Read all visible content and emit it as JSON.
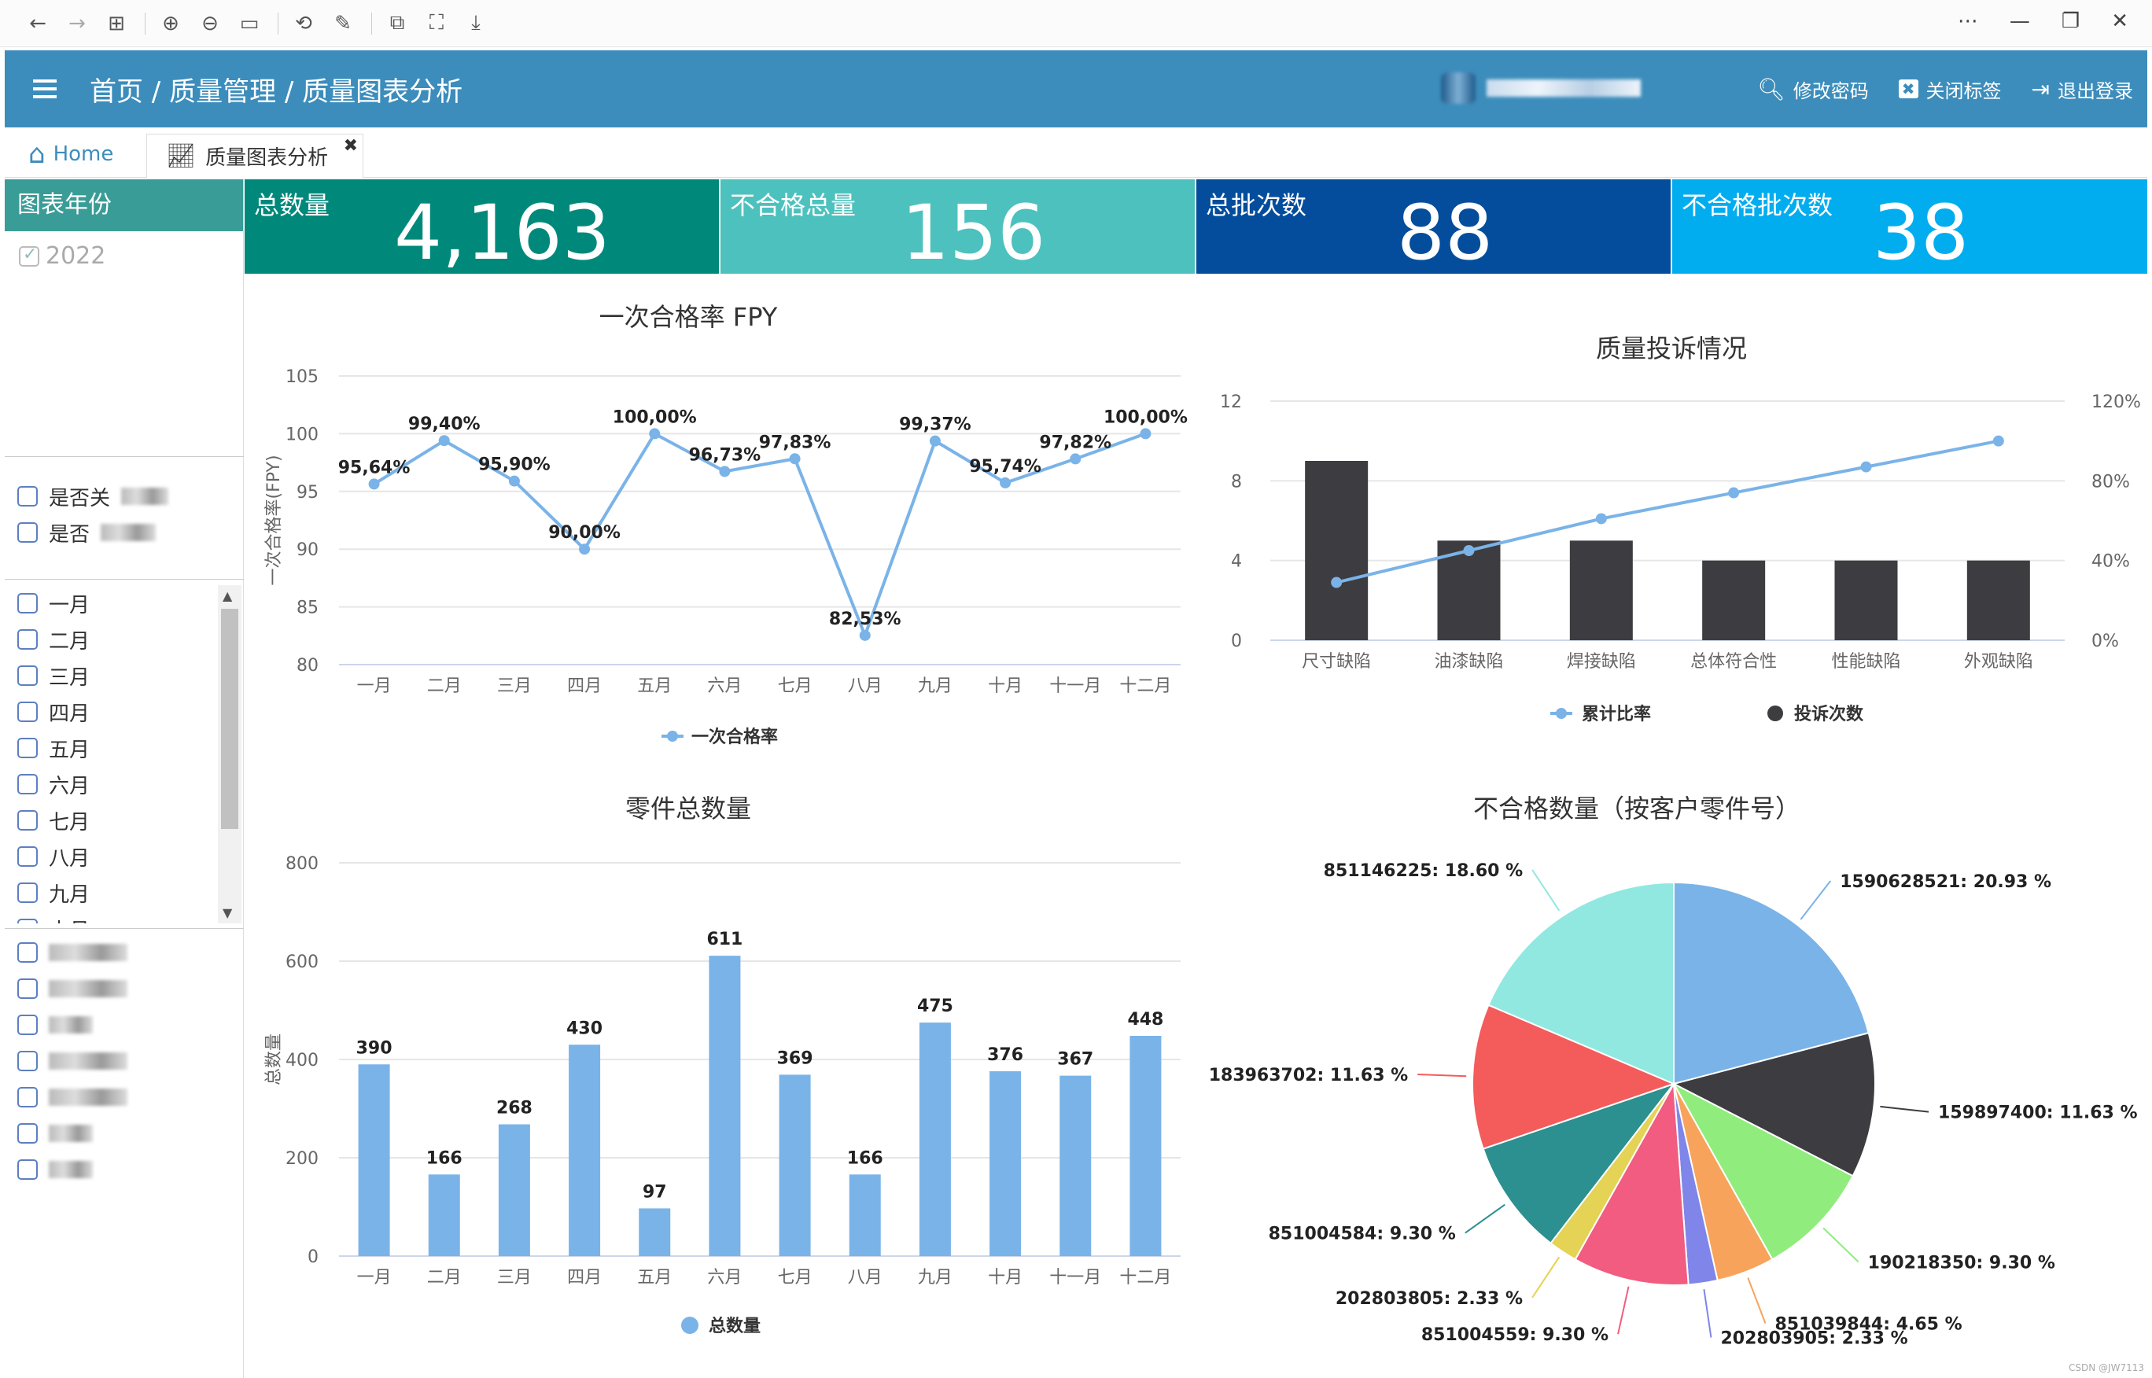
{
  "header": {
    "breadcrumb": "首页 / 质量管理 / 质量图表分析",
    "actions": [
      "修改密码",
      "关闭标签",
      "退出登录"
    ],
    "color": "#3c8dbc"
  },
  "tabs": {
    "home": "Home",
    "active": "质量图表分析"
  },
  "sidebar": {
    "title": "图表年份",
    "year": "2022",
    "group1": [
      "是否关",
      "是否"
    ],
    "months": [
      "一月",
      "二月",
      "三月",
      "四月",
      "五月",
      "六月",
      "七月",
      "八月",
      "九月",
      "十月"
    ]
  },
  "kpis": [
    {
      "label": "总数量",
      "value": "4,163",
      "color": "#00897b"
    },
    {
      "label": "不合格总量",
      "value": "156",
      "color": "#4dc1bd"
    },
    {
      "label": "总批次数",
      "value": "88",
      "color": "#034d9c"
    },
    {
      "label": "不合格批次数",
      "value": "38",
      "color": "#02adef"
    }
  ],
  "footer_credit": "CSDN @JW7113",
  "chart_data": [
    {
      "type": "line",
      "title": "一次合格率 FPY",
      "ylabel": "一次合格率(FPY)",
      "categories": [
        "一月",
        "二月",
        "三月",
        "四月",
        "五月",
        "六月",
        "七月",
        "八月",
        "九月",
        "十月",
        "十一月",
        "十二月"
      ],
      "series": [
        {
          "name": "一次合格率",
          "values": [
            95.64,
            99.4,
            95.9,
            90.0,
            100.0,
            96.73,
            97.83,
            82.53,
            99.37,
            95.74,
            97.82,
            100.0
          ],
          "labels": [
            "95,64%",
            "99,40%",
            "95,90%",
            "90,00%",
            "100,00%",
            "96,73%",
            "97,83%",
            "82,53%",
            "99,37%",
            "95,74%",
            "97,82%",
            "100,00%"
          ]
        }
      ],
      "ylim": [
        80,
        105
      ],
      "yticks": [
        "80",
        "85",
        "90",
        "95",
        "100",
        "105"
      ],
      "color": "#7ab3e8"
    },
    {
      "type": "bar",
      "title": "质量投诉情况",
      "categories": [
        "尺寸缺陷",
        "油漆缺陷",
        "焊接缺陷",
        "总体符合性",
        "性能缺陷",
        "外观缺陷"
      ],
      "series": [
        {
          "name": "投诉次数",
          "values": [
            9,
            5,
            5,
            4,
            4,
            4
          ],
          "color": "#3d3c41"
        },
        {
          "name": "累计比率",
          "values": [
            29,
            45,
            61,
            74,
            87,
            100
          ],
          "color": "#7ab3e8"
        }
      ],
      "ylim": [
        0,
        12
      ],
      "yticks": [
        "0",
        "4",
        "8",
        "12"
      ],
      "y2ticks": [
        "0%",
        "40%",
        "80%",
        "120%"
      ]
    },
    {
      "type": "bar",
      "title": "零件总数量",
      "ylabel": "总数量",
      "categories": [
        "一月",
        "二月",
        "三月",
        "四月",
        "五月",
        "六月",
        "七月",
        "八月",
        "九月",
        "十月",
        "十一月",
        "十二月"
      ],
      "series": [
        {
          "name": "总数量",
          "values": [
            390,
            166,
            268,
            430,
            97,
            611,
            369,
            166,
            475,
            376,
            367,
            448
          ]
        }
      ],
      "ylim": [
        0,
        800
      ],
      "yticks": [
        "0",
        "200",
        "400",
        "600",
        "800"
      ],
      "color": "#7ab3e8"
    },
    {
      "type": "pie",
      "title": "不合格数量（按客户零件号）",
      "slices": [
        {
          "label": "1590628521: 20.93 %",
          "value": 20.93,
          "color": "#7ab3e8"
        },
        {
          "label": "159897400: 11.63 %",
          "value": 11.63,
          "color": "#3d3c41"
        },
        {
          "label": "190218350: 9.30 %",
          "value": 9.3,
          "color": "#90ed7d"
        },
        {
          "label": "851039844: 4.65 %",
          "value": 4.65,
          "color": "#f7a35c"
        },
        {
          "label": "202803905: 2.33 %",
          "value": 2.33,
          "color": "#8085e9"
        },
        {
          "label": "851004559: 9.30 %",
          "value": 9.3,
          "color": "#f15c80"
        },
        {
          "label": "202803805: 2.33 %",
          "value": 2.33,
          "color": "#e4d354"
        },
        {
          "label": "851004584: 9.30 %",
          "value": 9.3,
          "color": "#2b908f"
        },
        {
          "label": "183963702: 11.63 %",
          "value": 11.63,
          "color": "#f45b5b"
        },
        {
          "label": "851146225: 18.60 %",
          "value": 18.6,
          "color": "#91e8e1"
        }
      ]
    }
  ]
}
